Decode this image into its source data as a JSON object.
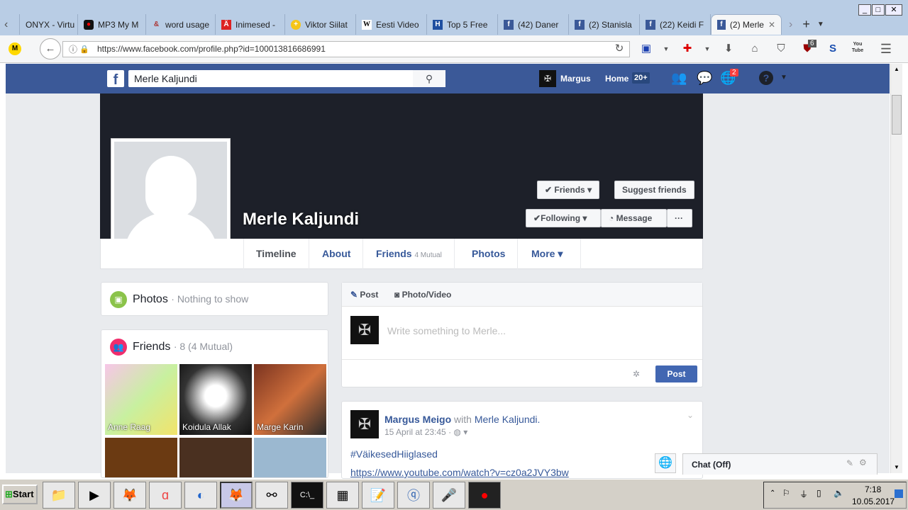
{
  "browser": {
    "tabs": [
      {
        "label": "ONYX - Virtu",
        "icon": "none"
      },
      {
        "label": "MP3 My M",
        "icon": "record-icon"
      },
      {
        "label": "word usage",
        "icon": "ampersand-icon"
      },
      {
        "label": "Inimesed -",
        "icon": "a-umlaut-icon"
      },
      {
        "label": "Viktor Siilat",
        "icon": "plus-circle-icon"
      },
      {
        "label": "Eesti Video",
        "icon": "wikipedia-icon"
      },
      {
        "label": "Top 5 Free",
        "icon": "h-icon"
      },
      {
        "label": "(42) Daner",
        "icon": "facebook-icon"
      },
      {
        "label": "(2) Stanisla",
        "icon": "facebook-icon"
      },
      {
        "label": "(22) Keidi F",
        "icon": "facebook-icon"
      },
      {
        "label": "(2) Merle",
        "icon": "facebook-icon",
        "active": true
      }
    ],
    "url": "https://www.facebook.com/profile.php?id=100013816686991",
    "ublock_count": "6",
    "youtube_label": "You Tube"
  },
  "fb": {
    "search_value": "Merle Kaljundi",
    "user": "Margus",
    "home": "Home",
    "home_count": "20+",
    "notif_count": "2",
    "profile_name": "Merle Kaljundi",
    "friends_btn": "Friends",
    "suggest_btn": "Suggest friends",
    "following_btn": "Following",
    "message_btn": "Message",
    "more_dots": "···",
    "tabs": {
      "timeline": "Timeline",
      "about": "About",
      "friends": "Friends",
      "mutual": "4 Mutual",
      "photos": "Photos",
      "more": "More"
    },
    "photos_title": "Photos",
    "photos_sub": "· Nothing to show",
    "friends_title": "Friends",
    "friends_sub": "· 8 (4 Mutual)",
    "friends": [
      "Anne Raag",
      "Koidula Allak",
      "Marge Karin",
      "",
      "",
      ""
    ],
    "composer": {
      "post_tab": "Post",
      "photo_tab": "Photo/Video",
      "placeholder": "Write something to Merle...",
      "post_btn": "Post"
    },
    "post": {
      "author": "Margus Meigo",
      "with": "with",
      "tagged": "Merle Kaljundi.",
      "time": "15 April at 23:45 ·",
      "hashtag": "#VäikesedHiiglased",
      "link": "https://www.youtube.com/watch?v=cz0a2JVY3bw"
    },
    "chat": "Chat (Off)"
  },
  "taskbar": {
    "start": "Start",
    "time": "7:18",
    "date": "10.05.2017"
  }
}
